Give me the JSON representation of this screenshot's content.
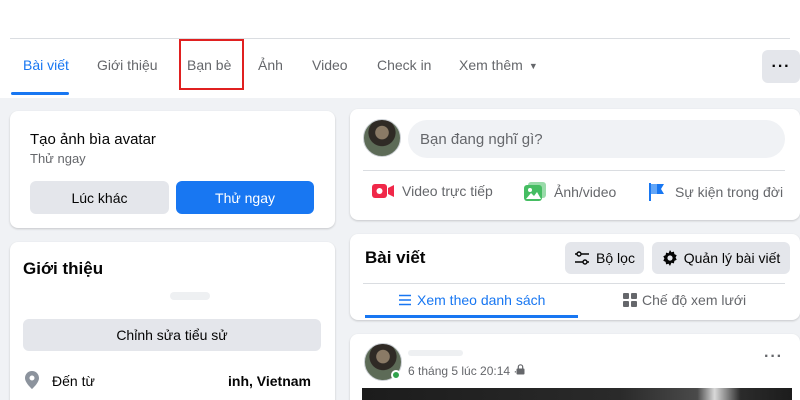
{
  "profile_tabs": {
    "items": [
      {
        "label": "Bài viết"
      },
      {
        "label": "Giới thiệu"
      },
      {
        "label": "Bạn bè"
      },
      {
        "label": "Ảnh"
      },
      {
        "label": "Video"
      },
      {
        "label": "Check in"
      },
      {
        "label": "Xem thêm"
      }
    ],
    "more_options": "···"
  },
  "avatar_card": {
    "title": "Tạo ảnh bìa avatar",
    "subtitle": "Thử ngay",
    "later_button": "Lúc khác",
    "try_button": "Thử ngay"
  },
  "composer": {
    "placeholder": "Bạn đang nghĩ gì?",
    "actions": [
      {
        "label": "Video trực tiếp",
        "icon": "live-video-icon"
      },
      {
        "label": "Ảnh/video",
        "icon": "photo-icon"
      },
      {
        "label": "Sự kiện trong đời",
        "icon": "life-event-flag-icon"
      }
    ]
  },
  "intro_card": {
    "title": "Giới thiệu",
    "edit_bio_button": "Chỉnh sửa tiểu sử",
    "from_label": "Đến từ",
    "from_place": "inh, Vietnam"
  },
  "posts_card": {
    "title": "Bài viết",
    "filter_button": "Bộ lọc",
    "manage_button": "Quản lý bài viết",
    "list_view_tab": "Xem theo danh sách",
    "grid_view_tab": "Chế độ xem lưới"
  },
  "post": {
    "timestamp": "6 tháng 5 lúc 20:14 ·",
    "more_options": "···"
  },
  "colors": {
    "accent": "#1877f2",
    "highlight_box": "#e02020",
    "live_video": "#f02849",
    "photo": "#45bd62",
    "life_event": "#1877f2",
    "online": "#31a24c"
  }
}
